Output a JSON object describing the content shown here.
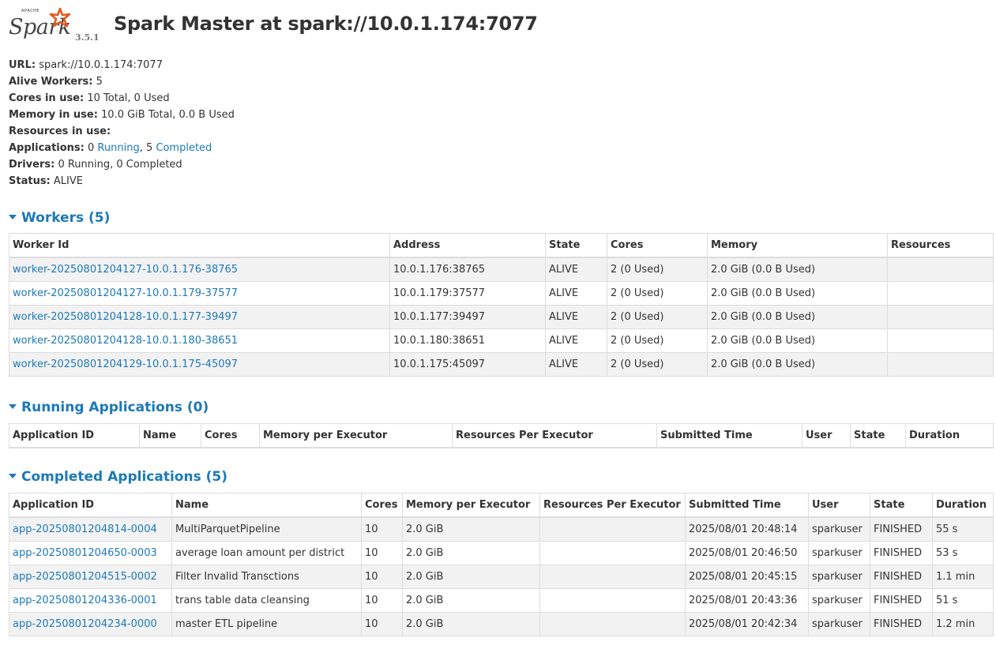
{
  "header": {
    "logo_apache": "APACHE",
    "logo_text": "Spark",
    "version": "3.5.1",
    "title": "Spark Master at spark://10.0.1.174:7077"
  },
  "info": {
    "url_label": "URL:",
    "url_value": "spark://10.0.1.174:7077",
    "alive_workers_label": "Alive Workers:",
    "alive_workers_value": "5",
    "cores_label": "Cores in use:",
    "cores_value": "10 Total, 0 Used",
    "memory_label": "Memory in use:",
    "memory_value": "10.0 GiB Total, 0.0 B Used",
    "resources_label": "Resources in use:",
    "applications_label": "Applications:",
    "applications_running_count": "0",
    "applications_running_link": "Running",
    "applications_sep": ",",
    "applications_completed_count": "5",
    "applications_completed_link": "Completed",
    "drivers_label": "Drivers:",
    "drivers_value": "0 Running, 0 Completed",
    "status_label": "Status:",
    "status_value": "ALIVE"
  },
  "workers": {
    "heading": "Workers (5)",
    "columns": [
      "Worker Id",
      "Address",
      "State",
      "Cores",
      "Memory",
      "Resources"
    ],
    "rows": [
      {
        "id": "worker-20250801204127-10.0.1.176-38765",
        "address": "10.0.1.176:38765",
        "state": "ALIVE",
        "cores": "2 (0 Used)",
        "memory": "2.0 GiB (0.0 B Used)",
        "resources": ""
      },
      {
        "id": "worker-20250801204127-10.0.1.179-37577",
        "address": "10.0.1.179:37577",
        "state": "ALIVE",
        "cores": "2 (0 Used)",
        "memory": "2.0 GiB (0.0 B Used)",
        "resources": ""
      },
      {
        "id": "worker-20250801204128-10.0.1.177-39497",
        "address": "10.0.1.177:39497",
        "state": "ALIVE",
        "cores": "2 (0 Used)",
        "memory": "2.0 GiB (0.0 B Used)",
        "resources": ""
      },
      {
        "id": "worker-20250801204128-10.0.1.180-38651",
        "address": "10.0.1.180:38651",
        "state": "ALIVE",
        "cores": "2 (0 Used)",
        "memory": "2.0 GiB (0.0 B Used)",
        "resources": ""
      },
      {
        "id": "worker-20250801204129-10.0.1.175-45097",
        "address": "10.0.1.175:45097",
        "state": "ALIVE",
        "cores": "2 (0 Used)",
        "memory": "2.0 GiB (0.0 B Used)",
        "resources": ""
      }
    ]
  },
  "running": {
    "heading": "Running Applications (0)",
    "columns": [
      "Application ID",
      "Name",
      "Cores",
      "Memory per Executor",
      "Resources Per Executor",
      "Submitted Time",
      "User",
      "State",
      "Duration"
    ]
  },
  "completed": {
    "heading": "Completed Applications (5)",
    "columns": [
      "Application ID",
      "Name",
      "Cores",
      "Memory per Executor",
      "Resources Per Executor",
      "Submitted Time",
      "User",
      "State",
      "Duration"
    ],
    "rows": [
      {
        "id": "app-20250801204814-0004",
        "name": "MultiParquetPipeline",
        "cores": "10",
        "memory": "2.0 GiB",
        "resources": "",
        "submitted": "2025/08/01 20:48:14",
        "user": "sparkuser",
        "state": "FINISHED",
        "duration": "55 s"
      },
      {
        "id": "app-20250801204650-0003",
        "name": "average loan amount per district",
        "cores": "10",
        "memory": "2.0 GiB",
        "resources": "",
        "submitted": "2025/08/01 20:46:50",
        "user": "sparkuser",
        "state": "FINISHED",
        "duration": "53 s"
      },
      {
        "id": "app-20250801204515-0002",
        "name": "Filter Invalid Transctions",
        "cores": "10",
        "memory": "2.0 GiB",
        "resources": "",
        "submitted": "2025/08/01 20:45:15",
        "user": "sparkuser",
        "state": "FINISHED",
        "duration": "1.1 min"
      },
      {
        "id": "app-20250801204336-0001",
        "name": "trans table data cleansing",
        "cores": "10",
        "memory": "2.0 GiB",
        "resources": "",
        "submitted": "2025/08/01 20:43:36",
        "user": "sparkuser",
        "state": "FINISHED",
        "duration": "51 s"
      },
      {
        "id": "app-20250801204234-0000",
        "name": "master ETL pipeline",
        "cores": "10",
        "memory": "2.0 GiB",
        "resources": "",
        "submitted": "2025/08/01 20:42:34",
        "user": "sparkuser",
        "state": "FINISHED",
        "duration": "1.2 min"
      }
    ]
  },
  "colors": {
    "link": "#1c79b7",
    "text": "#333333",
    "row_stripe": "#f2f2f2",
    "border": "#dddddd",
    "logo_star": "#e25a1c"
  }
}
